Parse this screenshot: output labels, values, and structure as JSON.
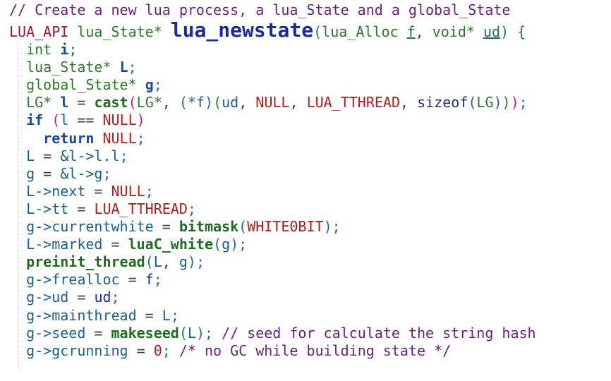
{
  "code": {
    "lines": [
      {
        "tokens": [
          {
            "t": "// Create a new lua process, a lua_State and a global_State",
            "c": "comment"
          }
        ]
      },
      {
        "big": true,
        "tokens": [
          {
            "t": "LUA_API",
            "c": "macro"
          },
          {
            "t": " ",
            "c": "op"
          },
          {
            "t": "lua_State*",
            "c": "type"
          },
          {
            "t": " ",
            "c": "op"
          },
          {
            "t": "lua_newstate",
            "c": "fn-big"
          },
          {
            "t": "(",
            "c": "punct"
          },
          {
            "t": "lua_Alloc",
            "c": "type"
          },
          {
            "t": " ",
            "c": "op"
          },
          {
            "t": "f",
            "c": "param"
          },
          {
            "t": ", ",
            "c": "op"
          },
          {
            "t": "void*",
            "c": "type"
          },
          {
            "t": " ",
            "c": "op"
          },
          {
            "t": "ud",
            "c": "param"
          },
          {
            "t": ") {",
            "c": "punct"
          }
        ]
      },
      {
        "tokens": [
          {
            "t": "  ",
            "c": "op"
          },
          {
            "t": "int",
            "c": "type"
          },
          {
            "t": " ",
            "c": "op"
          },
          {
            "t": "i",
            "c": "kw"
          },
          {
            "t": ";",
            "c": "punct"
          }
        ]
      },
      {
        "tokens": [
          {
            "t": "  ",
            "c": "op"
          },
          {
            "t": "lua_State*",
            "c": "type"
          },
          {
            "t": " ",
            "c": "op"
          },
          {
            "t": "L",
            "c": "kw"
          },
          {
            "t": ";",
            "c": "punct"
          }
        ]
      },
      {
        "tokens": [
          {
            "t": "  ",
            "c": "op"
          },
          {
            "t": "global_State*",
            "c": "type"
          },
          {
            "t": " ",
            "c": "op"
          },
          {
            "t": "g",
            "c": "kw"
          },
          {
            "t": ";",
            "c": "punct"
          }
        ]
      },
      {
        "tokens": [
          {
            "t": "  ",
            "c": "op"
          },
          {
            "t": "LG*",
            "c": "type"
          },
          {
            "t": " ",
            "c": "op"
          },
          {
            "t": "l",
            "c": "kw"
          },
          {
            "t": " = ",
            "c": "op"
          },
          {
            "t": "cast",
            "c": "call"
          },
          {
            "t": "(",
            "c": "paren"
          },
          {
            "t": "LG*",
            "c": "type"
          },
          {
            "t": ", ",
            "c": "op"
          },
          {
            "t": "(*",
            "c": "punct"
          },
          {
            "t": "f",
            "c": "member"
          },
          {
            "t": ")",
            "c": "punct"
          },
          {
            "t": "(",
            "c": "paren2"
          },
          {
            "t": "ud",
            "c": "member"
          },
          {
            "t": ", ",
            "c": "op"
          },
          {
            "t": "NULL",
            "c": "const"
          },
          {
            "t": ", ",
            "c": "op"
          },
          {
            "t": "LUA_TTHREAD",
            "c": "const"
          },
          {
            "t": ", ",
            "c": "op"
          },
          {
            "t": "sizeof",
            "c": "ident"
          },
          {
            "t": "(",
            "c": "punct"
          },
          {
            "t": "LG",
            "c": "type"
          },
          {
            "t": ")",
            "c": "punct"
          },
          {
            "t": ")",
            "c": "paren2"
          },
          {
            "t": ")",
            "c": "paren"
          },
          {
            "t": ";",
            "c": "punct"
          }
        ]
      },
      {
        "tokens": [
          {
            "t": "  ",
            "c": "op"
          },
          {
            "t": "if",
            "c": "kw"
          },
          {
            "t": " ",
            "c": "op"
          },
          {
            "t": "(",
            "c": "paren"
          },
          {
            "t": "l",
            "c": "member"
          },
          {
            "t": " == ",
            "c": "op"
          },
          {
            "t": "NULL",
            "c": "const"
          },
          {
            "t": ")",
            "c": "paren"
          }
        ]
      },
      {
        "tokens": [
          {
            "t": "    ",
            "c": "op"
          },
          {
            "t": "return",
            "c": "kw"
          },
          {
            "t": " ",
            "c": "op"
          },
          {
            "t": "NULL",
            "c": "const"
          },
          {
            "t": ";",
            "c": "punct"
          }
        ]
      },
      {
        "tokens": [
          {
            "t": "  ",
            "c": "op"
          },
          {
            "t": "L",
            "c": "member"
          },
          {
            "t": " = ",
            "c": "op"
          },
          {
            "t": "&l->l.l",
            "c": "member"
          },
          {
            "t": ";",
            "c": "punct"
          }
        ]
      },
      {
        "tokens": [
          {
            "t": "  ",
            "c": "op"
          },
          {
            "t": "g",
            "c": "member"
          },
          {
            "t": " = ",
            "c": "op"
          },
          {
            "t": "&l->g",
            "c": "member"
          },
          {
            "t": ";",
            "c": "punct"
          }
        ]
      },
      {
        "tokens": [
          {
            "t": "  ",
            "c": "op"
          },
          {
            "t": "L->next",
            "c": "member"
          },
          {
            "t": " = ",
            "c": "op"
          },
          {
            "t": "NULL",
            "c": "const"
          },
          {
            "t": ";",
            "c": "punct"
          }
        ]
      },
      {
        "tokens": [
          {
            "t": "  ",
            "c": "op"
          },
          {
            "t": "L->tt",
            "c": "member"
          },
          {
            "t": " = ",
            "c": "op"
          },
          {
            "t": "LUA_TTHREAD",
            "c": "const"
          },
          {
            "t": ";",
            "c": "punct"
          }
        ]
      },
      {
        "tokens": [
          {
            "t": "  ",
            "c": "op"
          },
          {
            "t": "g->currentwhite",
            "c": "member"
          },
          {
            "t": " = ",
            "c": "op"
          },
          {
            "t": "bitmask",
            "c": "call"
          },
          {
            "t": "(",
            "c": "punct"
          },
          {
            "t": "WHITE0BIT",
            "c": "const"
          },
          {
            "t": ");",
            "c": "punct"
          }
        ]
      },
      {
        "tokens": [
          {
            "t": "  ",
            "c": "op"
          },
          {
            "t": "L->marked",
            "c": "member"
          },
          {
            "t": " = ",
            "c": "op"
          },
          {
            "t": "luaC_white",
            "c": "call"
          },
          {
            "t": "(",
            "c": "punct"
          },
          {
            "t": "g",
            "c": "member"
          },
          {
            "t": ");",
            "c": "punct"
          }
        ]
      },
      {
        "tokens": [
          {
            "t": "  ",
            "c": "op"
          },
          {
            "t": "preinit_thread",
            "c": "call"
          },
          {
            "t": "(",
            "c": "punct"
          },
          {
            "t": "L",
            "c": "member"
          },
          {
            "t": ", ",
            "c": "op"
          },
          {
            "t": "g",
            "c": "member"
          },
          {
            "t": ");",
            "c": "punct"
          }
        ]
      },
      {
        "tokens": [
          {
            "t": "  ",
            "c": "op"
          },
          {
            "t": "g->frealloc",
            "c": "member"
          },
          {
            "t": " = ",
            "c": "op"
          },
          {
            "t": "f",
            "c": "ident"
          },
          {
            "t": ";",
            "c": "punct"
          }
        ]
      },
      {
        "tokens": [
          {
            "t": "  ",
            "c": "op"
          },
          {
            "t": "g->ud",
            "c": "member"
          },
          {
            "t": " = ",
            "c": "op"
          },
          {
            "t": "ud",
            "c": "ident"
          },
          {
            "t": ";",
            "c": "punct"
          }
        ]
      },
      {
        "tokens": [
          {
            "t": "  ",
            "c": "op"
          },
          {
            "t": "g->mainthread",
            "c": "member"
          },
          {
            "t": " = ",
            "c": "op"
          },
          {
            "t": "L",
            "c": "member"
          },
          {
            "t": ";",
            "c": "punct"
          }
        ]
      },
      {
        "tokens": [
          {
            "t": "  ",
            "c": "op"
          },
          {
            "t": "g->seed",
            "c": "member"
          },
          {
            "t": " = ",
            "c": "op"
          },
          {
            "t": "makeseed",
            "c": "call"
          },
          {
            "t": "(",
            "c": "punct"
          },
          {
            "t": "L",
            "c": "member"
          },
          {
            "t": "); ",
            "c": "punct"
          },
          {
            "t": "// seed for calculate the string hash",
            "c": "comment"
          }
        ]
      },
      {
        "tokens": [
          {
            "t": "  ",
            "c": "op"
          },
          {
            "t": "g->gcrunning",
            "c": "member"
          },
          {
            "t": " = ",
            "c": "op"
          },
          {
            "t": "0",
            "c": "num"
          },
          {
            "t": "; ",
            "c": "punct"
          },
          {
            "t": "/* no GC while building state */",
            "c": "comment"
          }
        ]
      }
    ]
  }
}
